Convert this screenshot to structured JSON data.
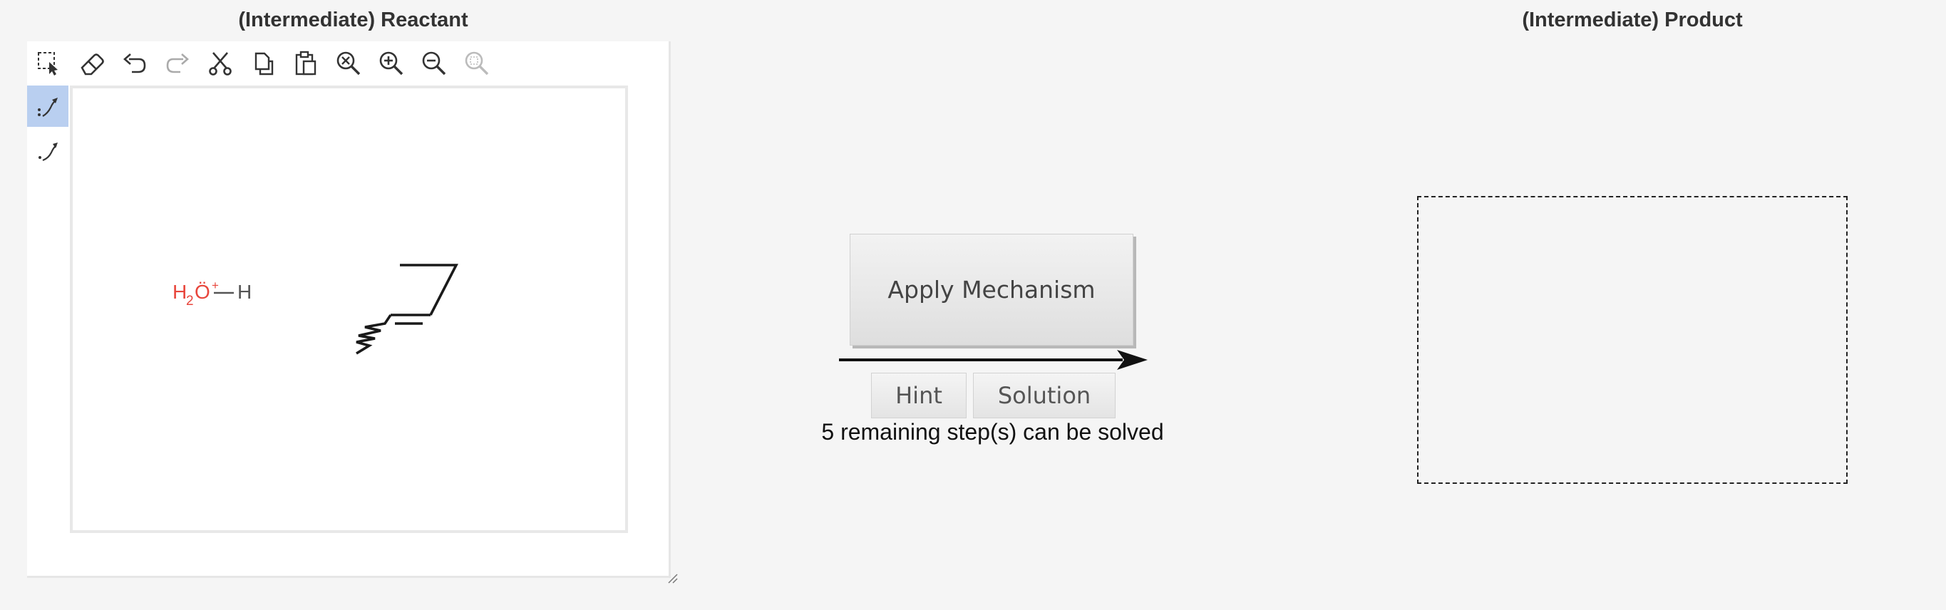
{
  "reactant_panel": {
    "title": "(Intermediate) Reactant",
    "toolbar": [
      {
        "name": "selection-icon",
        "enabled": true
      },
      {
        "name": "eraser-icon",
        "enabled": true
      },
      {
        "name": "undo-icon",
        "enabled": true
      },
      {
        "name": "redo-icon",
        "enabled": false
      },
      {
        "name": "cut-icon",
        "enabled": true
      },
      {
        "name": "copy-icon",
        "enabled": true
      },
      {
        "name": "paste-icon",
        "enabled": true
      },
      {
        "name": "zoom-reset-icon",
        "enabled": true
      },
      {
        "name": "zoom-in-icon",
        "enabled": true
      },
      {
        "name": "zoom-out-icon",
        "enabled": true
      },
      {
        "name": "zoom-fit-icon",
        "enabled": false
      }
    ],
    "side_tools": [
      {
        "name": "electron-pair-arrow-icon",
        "active": true
      },
      {
        "name": "single-electron-arrow-icon",
        "active": false
      }
    ],
    "molecule_hydronium": {
      "h2": "H",
      "sub2": "2",
      "oxygen": "Ö",
      "charge": "+",
      "h": "H",
      "color": "#e8463c"
    }
  },
  "actions": {
    "apply_label": "Apply Mechanism",
    "hint_label": "Hint",
    "solution_label": "Solution",
    "status_text": "5 remaining step(s) can be solved"
  },
  "product_panel": {
    "title": "(Intermediate) Product"
  },
  "colors": {
    "background": "#f5f5f5",
    "active_tool": "#b9cff0",
    "atom_oxygen": "#e8463c"
  }
}
